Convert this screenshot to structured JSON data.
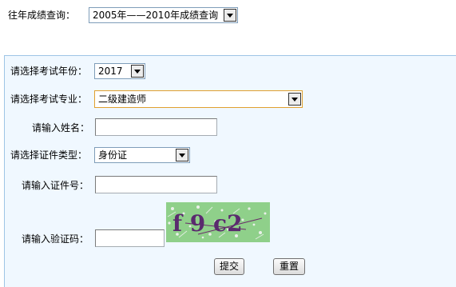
{
  "past_query": {
    "label": "往年成绩查询：",
    "selected": "2005年——2010年成绩查询"
  },
  "form": {
    "year": {
      "label": "请选择考试年份：",
      "selected": "2017"
    },
    "major": {
      "label": "请选择考试专业：",
      "selected": "二级建造师"
    },
    "name": {
      "label": "请输入姓名：",
      "value": ""
    },
    "id_type": {
      "label": "请选择证件类型：",
      "selected": "身份证"
    },
    "id_number": {
      "label": "请输入证件号：",
      "value": ""
    },
    "captcha": {
      "label": "请输入验证码：",
      "value": "",
      "image_text": "f 9 c2"
    },
    "submit_label": "提交",
    "reset_label": "重置"
  },
  "colors": {
    "panel_bg": "#f0f8ff",
    "panel_border": "#9ec5e6",
    "captcha_bg": "#8fd08a",
    "captcha_text": "#5a2a6e",
    "highlight_border": "#e0a030"
  }
}
